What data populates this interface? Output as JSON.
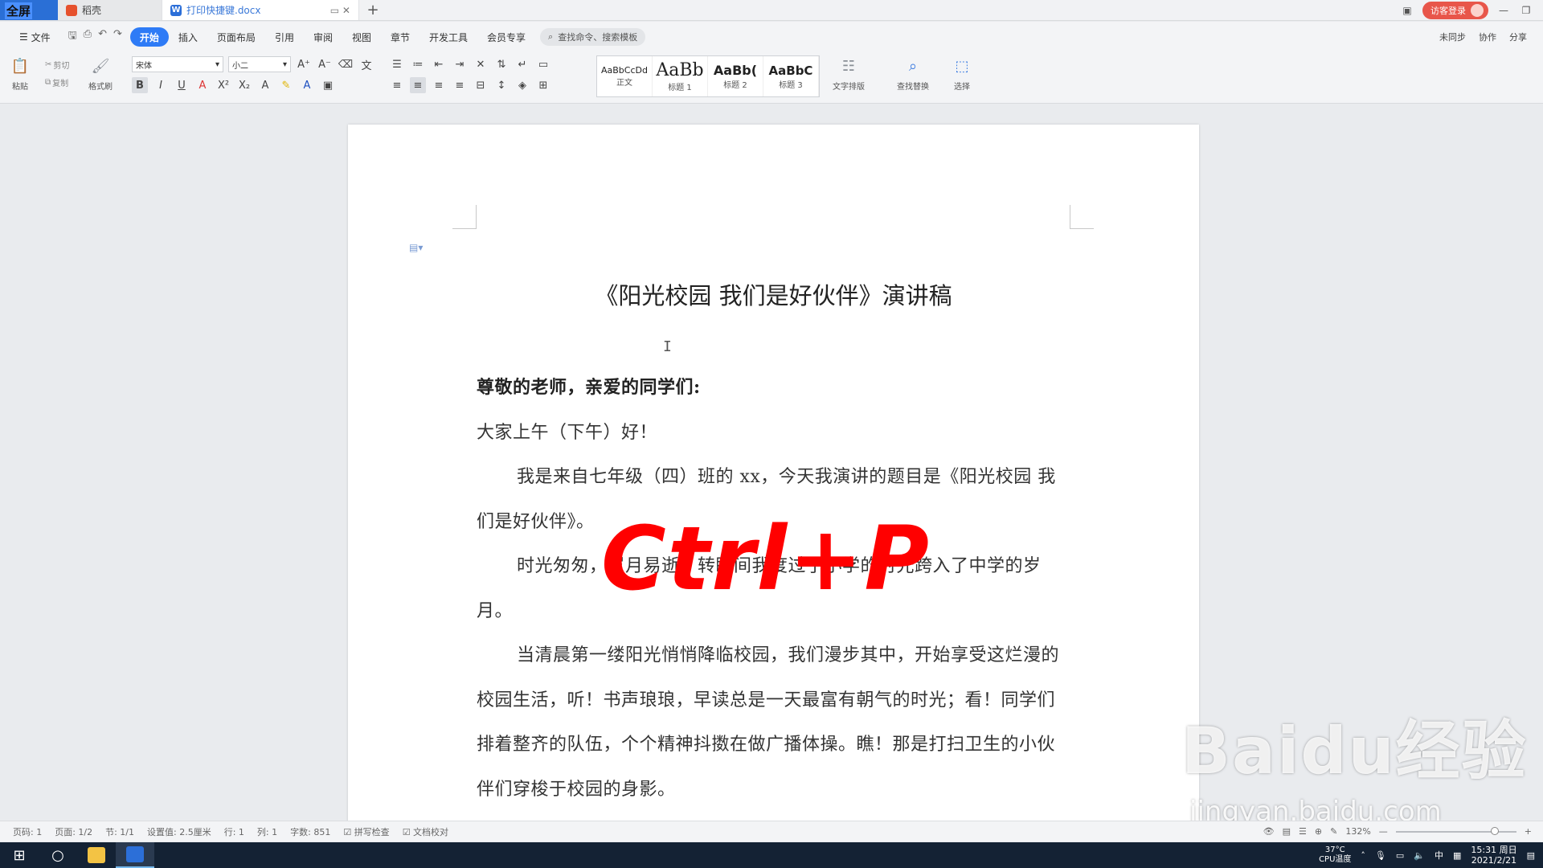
{
  "titlebar": {
    "home_label": "全屏",
    "tabs": [
      {
        "label": "稻壳",
        "icon": "wps-docer-icon"
      },
      {
        "label": "打印快捷键.docx",
        "icon": "wps-writer-icon"
      }
    ],
    "new_tab": "+",
    "login_label": "访客登录"
  },
  "menu": {
    "file_label": "文件",
    "tabs": [
      "开始",
      "插入",
      "页面布局",
      "引用",
      "审阅",
      "视图",
      "章节",
      "开发工具",
      "会员专享"
    ],
    "active_tab": "开始",
    "search_placeholder": "查找命令、搜索模板",
    "right": {
      "sync": "未同步",
      "collab": "协作",
      "share": "分享"
    }
  },
  "ribbon": {
    "paste": "粘贴",
    "cut": "剪切",
    "copy": "复制",
    "format_painter": "格式刷",
    "font_name": "宋体",
    "font_size": "小二",
    "styles": [
      {
        "preview": "AaBbCcDd",
        "name": "正文"
      },
      {
        "preview": "AaBb",
        "name": "标题 1"
      },
      {
        "preview": "AaBb(",
        "name": "标题 2"
      },
      {
        "preview": "AaBbC",
        "name": "标题 3"
      }
    ],
    "text_layout": "文字排版",
    "find_replace": "查找替换",
    "select": "选择"
  },
  "document": {
    "title": "《阳光校园  我们是好伙伴》演讲稿",
    "greeting": "尊敬的老师，亲爱的同学们:",
    "paragraphs": [
      "大家上午（下午）好！",
      "我是来自七年级（四）班的 xx，今天我演讲的题目是《阳光校园  我们是好伙伴》。",
      "时光匆匆，岁月易逝，转眼间我度过了小学的时光跨入了中学的岁月。",
      "当清晨第一缕阳光悄悄降临校园，我们漫步其中，开始享受这烂漫的校园生活，听！书声琅琅，早读总是一天最富有朝气的时光；看！同学们排着整齐的队伍，个个精神抖擞在做广播体操。瞧！那是打扫卫生的小伙伴们穿梭于校园的身影。"
    ]
  },
  "overlay": {
    "shortcut": "Ctrl+P",
    "color": "#ff0000"
  },
  "watermark": {
    "brand": "Baidu经验",
    "url": "jingyan.baidu.com"
  },
  "statusbar": {
    "page": "页码: 1",
    "pages": "页面: 1/2",
    "section": "节: 1/1",
    "setting": "设置值: 2.5厘米",
    "row": "行: 1",
    "col": "列: 1",
    "words": "字数: 851",
    "spellcheck": "拼写检查",
    "proofread": "文档校对",
    "zoom": "132%"
  },
  "taskbar": {
    "temp": "37°C",
    "cpu": "CPU温度",
    "ime": "中",
    "time": "15:31 周日",
    "date": "2021/2/21"
  }
}
